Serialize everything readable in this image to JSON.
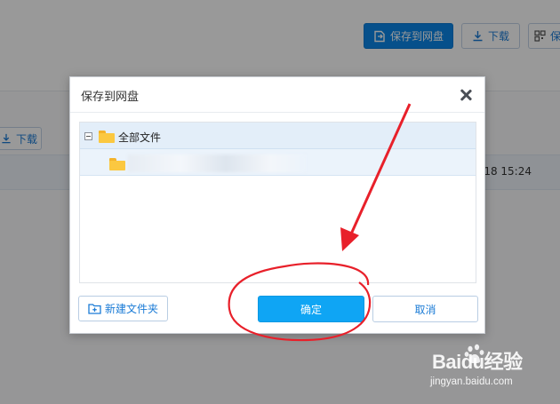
{
  "background": {
    "toolbar": {
      "save_to_netdisk": "保存到网盘",
      "download": "下载",
      "share_label": "保"
    },
    "list_toolbar": {
      "download": "下载"
    },
    "file_row": {
      "time": "-18 15:24"
    }
  },
  "dialog": {
    "title": "保存到网盘",
    "tree": {
      "root_label": "全部文件",
      "child_label": ""
    },
    "buttons": {
      "new_folder": "新建文件夹",
      "confirm": "确定",
      "cancel": "取消"
    }
  },
  "watermark": {
    "brand": "Baidu经验",
    "url": "jingyan.baidu.com"
  },
  "colors": {
    "primary": "#0a86e8",
    "confirm": "#0fa5f4",
    "annotation": "#e8202a",
    "folder": "#fbc840"
  },
  "icons": {
    "save": "save-to-netdisk-icon",
    "download": "download-icon",
    "share": "share-icon",
    "close": "close-icon",
    "collapse": "collapse-minus-icon",
    "folder": "folder-icon",
    "new_folder": "new-folder-icon"
  }
}
